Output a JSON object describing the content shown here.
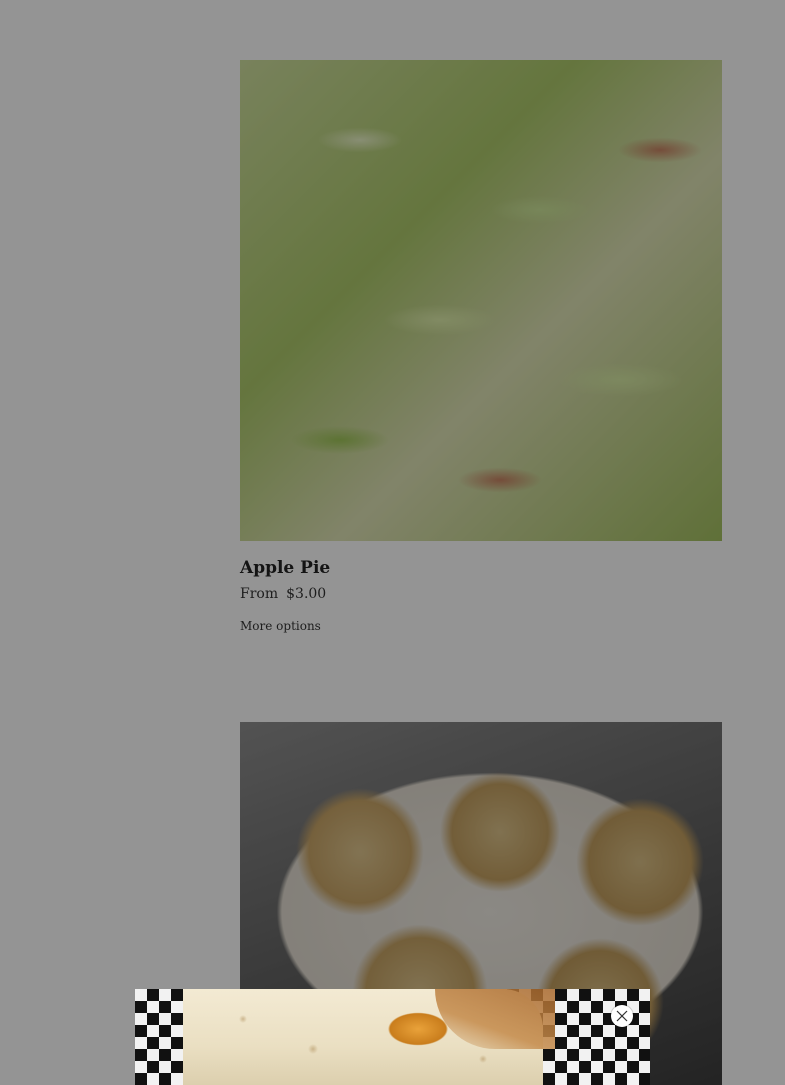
{
  "products": [
    {
      "image_alt": "Apple Pie",
      "title": "Apple Pie",
      "price_prefix": "From",
      "price": "$3.00",
      "more_options_label": "More options"
    },
    {
      "image_alt": ""
    }
  ],
  "popup": {
    "close_icon": "close-icon"
  },
  "colors": {
    "overlay": "rgba(0,0,0,0.4)",
    "popup_close_bg": "#ffffff"
  }
}
